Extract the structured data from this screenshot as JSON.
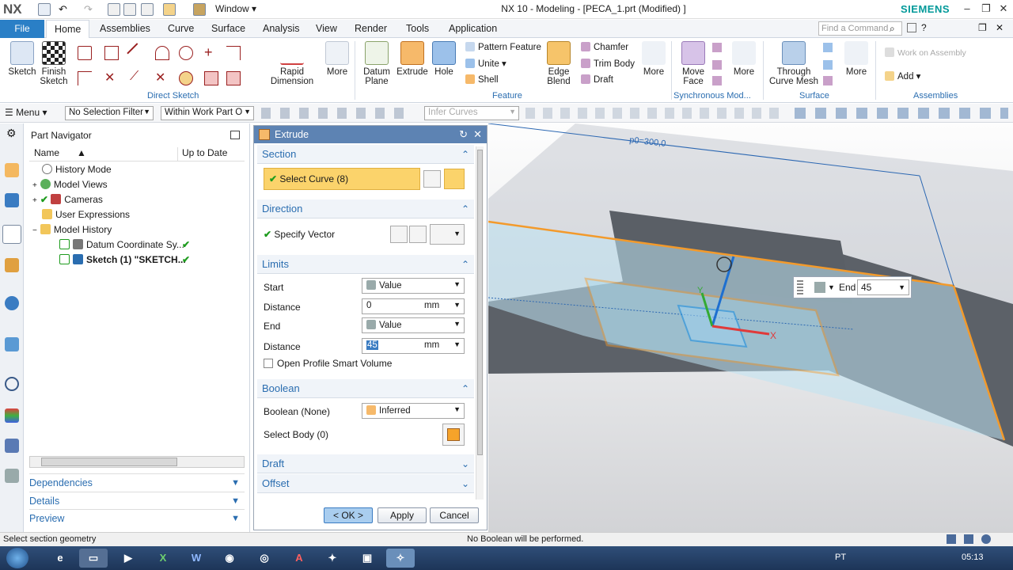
{
  "titlebar": {
    "logo": "NX",
    "window_menu": "Window ▾",
    "app_title": "NX 10 - Modeling - [PECA_1.prt (Modified) ]",
    "brand": "SIEMENS"
  },
  "tabs": {
    "file": "File",
    "items": [
      "Home",
      "Assemblies",
      "Curve",
      "Surface",
      "Analysis",
      "View",
      "Render",
      "Tools",
      "Application"
    ],
    "find_placeholder": "Find a Command"
  },
  "ribbon": {
    "sketch": "Sketch",
    "finish_sketch": "Finish Sketch",
    "rapid_dimension": "Rapid Dimension",
    "more": "More",
    "direct_sketch_label": "Direct Sketch",
    "datum_plane": "Datum Plane",
    "extrude": "Extrude",
    "hole": "Hole",
    "pattern_feature": "Pattern Feature",
    "unite": "Unite",
    "shell": "Shell",
    "edge_blend": "Edge Blend",
    "chamfer": "Chamfer",
    "trim_body": "Trim Body",
    "draft": "Draft",
    "feature_label": "Feature",
    "move_face": "Move Face",
    "synchronous_label": "Synchronous Mod...",
    "through_curve_mesh": "Through Curve Mesh",
    "surface_label": "Surface",
    "work_on_assembly": "Work on Assembly",
    "add": "Add",
    "assemblies_label": "Assemblies"
  },
  "selbar": {
    "menu": "Menu",
    "selection_filter": "No Selection Filter",
    "scope": "Within Work Part O",
    "snap": "Infer Curves"
  },
  "part_navigator": {
    "title": "Part Navigator",
    "col_name": "Name",
    "col_uptodate": "Up to Date",
    "rows": [
      {
        "label": "History Mode",
        "check": ""
      },
      {
        "label": "Model Views",
        "check": ""
      },
      {
        "label": "Cameras",
        "check": ""
      },
      {
        "label": "User Expressions",
        "check": ""
      },
      {
        "label": "Model History",
        "check": ""
      },
      {
        "label": "Datum Coordinate Sy...",
        "check": "✔"
      },
      {
        "label": "Sketch (1) \"SKETCH...",
        "check": "✔"
      }
    ],
    "panels": [
      "Dependencies",
      "Details",
      "Preview"
    ]
  },
  "extrude": {
    "title": "Extrude",
    "section": "Section",
    "select_curve": "Select Curve (8)",
    "direction": "Direction",
    "specify_vector": "Specify Vector",
    "limits": "Limits",
    "start_label": "Start",
    "start_value": "Value",
    "distance_label": "Distance",
    "start_distance": "0",
    "unit": "mm",
    "end_label": "End",
    "end_value": "Value",
    "end_distance": "45",
    "open_profile": "Open Profile Smart Volume",
    "boolean": "Boolean",
    "boolean_label": "Boolean (None)",
    "boolean_value": "Inferred",
    "select_body": "Select Body (0)",
    "draft": "Draft",
    "offset": "Offset",
    "ok": "< OK >",
    "apply": "Apply",
    "cancel": "Cancel"
  },
  "viewport": {
    "p0_label": "p0=300,0",
    "end_label": "End",
    "end_value": "45",
    "x_axis": "X",
    "y_axis": "Y"
  },
  "status": {
    "left": "Select section geometry",
    "center": "No Boolean will be performed."
  },
  "taskbar": {
    "lang": "PT",
    "time": "05:13"
  },
  "colors": {
    "accent": "#2a7fc6",
    "highlight": "#fbd36b",
    "preview_edge": "#f39a2b",
    "check": "#1d9b1d"
  }
}
